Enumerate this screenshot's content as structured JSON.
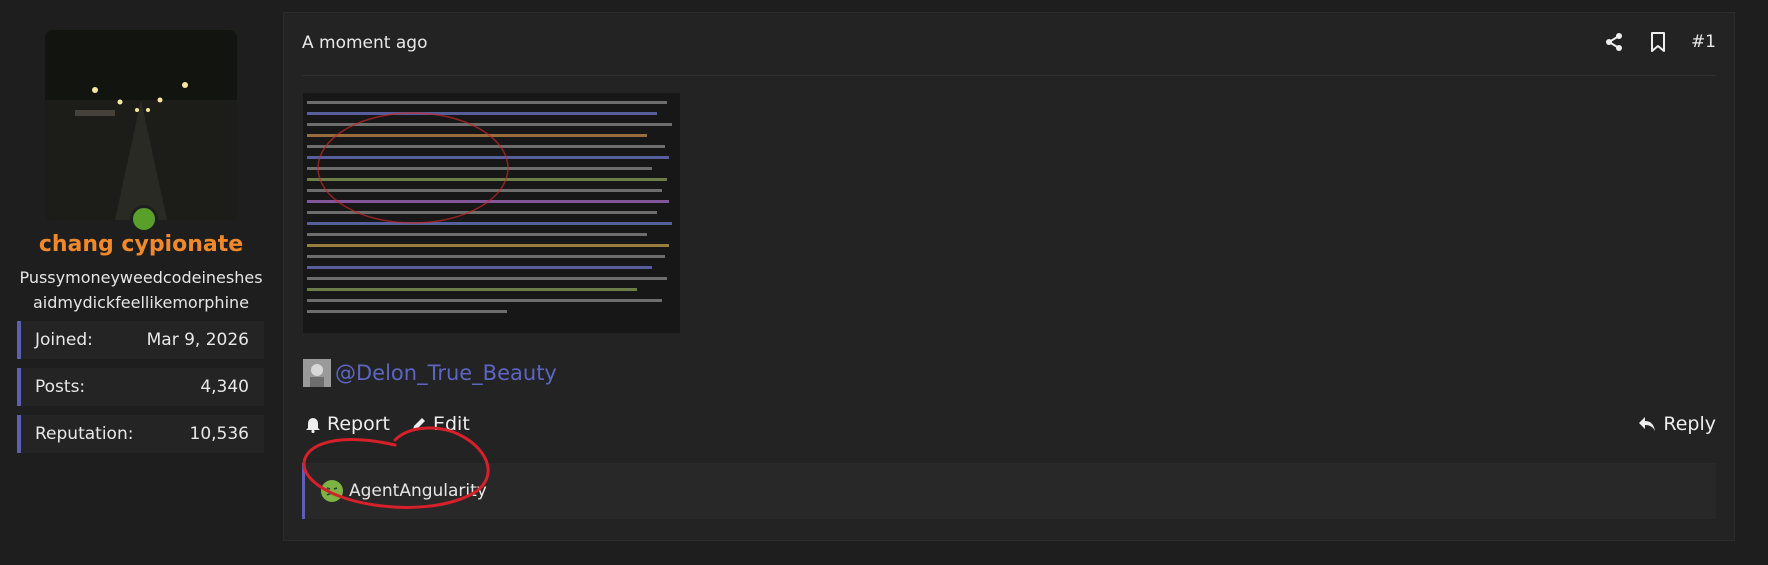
{
  "user": {
    "name": "chang cypionate",
    "title": "Pussymoneyweedcodeineshesaidmydickfeellikemorphine",
    "online": true,
    "stats": [
      {
        "label": "Joined:",
        "value": "Mar 9, 2026"
      },
      {
        "label": "Posts:",
        "value": "4,340"
      },
      {
        "label": "Reputation:",
        "value": "10,536"
      }
    ]
  },
  "post": {
    "timestamp": "A moment ago",
    "number": "#1",
    "mention": "@Delon_True_Beauty",
    "actions": {
      "report": "Report",
      "edit": "Edit",
      "reply": "Reply"
    },
    "reaction": {
      "user": "AgentAngularity",
      "emoji": "sick-face-icon"
    }
  },
  "colors": {
    "accent": "#5c5fb3",
    "username": "#f0892b",
    "mention": "#5c66c2",
    "annotation": "#d6202a"
  }
}
